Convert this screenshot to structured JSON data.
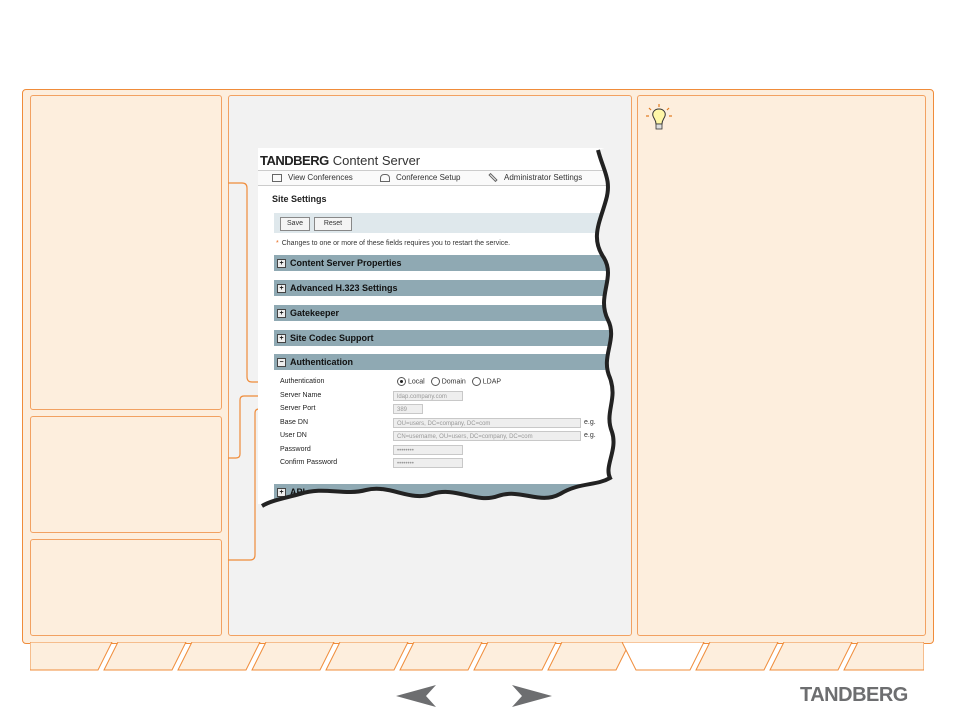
{
  "app": {
    "brand": "TANDBERG",
    "product": "Content Server"
  },
  "nav": {
    "items": [
      {
        "label": "View Conferences",
        "icon": "monitor-icon"
      },
      {
        "label": "Conference Setup",
        "icon": "phone-icon"
      },
      {
        "label": "Administrator Settings",
        "icon": "wrench-icon"
      }
    ]
  },
  "page": {
    "title": "Site Settings",
    "save_label": "Save",
    "reset_label": "Reset",
    "restart_note": "Changes to one or more of these fields requires you to restart the service."
  },
  "sections": [
    {
      "label": "Content Server Properties"
    },
    {
      "label": "Advanced H.323 Settings"
    },
    {
      "label": "Gatekeeper"
    },
    {
      "label": "Site Codec Support"
    },
    {
      "label": "Authentication"
    },
    {
      "label": "API"
    }
  ],
  "authentication": {
    "label": "Authentication",
    "options": [
      "Local",
      "Domain",
      "LDAP"
    ],
    "selected": "Local",
    "fields": [
      {
        "label": "Server Name",
        "value": "ldap.company.com"
      },
      {
        "label": "Server Port",
        "value": "389"
      },
      {
        "label": "Base DN",
        "value": "OU=users, DC=company, DC=com",
        "hint": "e.g."
      },
      {
        "label": "User DN",
        "value": "CN=username, OU=users, DC=company, DC=com",
        "hint": "e.g."
      },
      {
        "label": "Password",
        "value": "••••••••"
      },
      {
        "label": "Confirm Password",
        "value": "••••••••"
      }
    ]
  },
  "footer": {
    "brand": "TANDBERG"
  },
  "colors": {
    "accent": "#f08c3a",
    "panel": "#fdeedd",
    "section_bar": "#8fa9b3",
    "tab_active": "#ffffff"
  }
}
